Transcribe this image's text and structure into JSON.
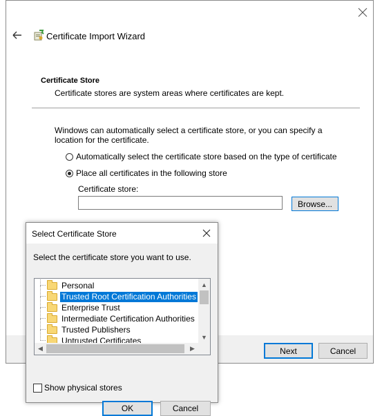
{
  "wizard": {
    "title": "Certificate Import Wizard",
    "section_title": "Certificate Store",
    "section_description": "Certificate stores are system areas where certificates are kept.",
    "info_text": "Windows can automatically select a certificate store, or you can specify a location for the certificate.",
    "radio_auto_label": "Automatically select the certificate store based on the type of certificate",
    "radio_auto_checked": false,
    "radio_place_label": "Place all certificates in the following store",
    "radio_place_checked": true,
    "store_label": "Certificate store:",
    "store_value": "",
    "browse_label": "Browse...",
    "next_label": "Next",
    "cancel_label": "Cancel"
  },
  "dialog": {
    "title": "Select Certificate Store",
    "prompt": "Select the certificate store you want to use.",
    "stores": [
      {
        "label": "Personal",
        "selected": false
      },
      {
        "label": "Trusted Root Certification Authorities",
        "selected": true
      },
      {
        "label": "Enterprise Trust",
        "selected": false
      },
      {
        "label": "Intermediate Certification Authorities",
        "selected": false
      },
      {
        "label": "Trusted Publishers",
        "selected": false
      },
      {
        "label": "Untrusted Certificates",
        "selected": false
      }
    ],
    "show_physical_label": "Show physical stores",
    "show_physical_checked": false,
    "ok_label": "OK",
    "cancel_label": "Cancel"
  },
  "colors": {
    "accent": "#0078d7",
    "footer_bg": "#f0f0f0",
    "folder": "#f8d775"
  },
  "icons": {
    "close": "close-icon",
    "back": "back-arrow-icon",
    "wizard": "certificate-wizard-icon",
    "folder": "folder-icon"
  }
}
